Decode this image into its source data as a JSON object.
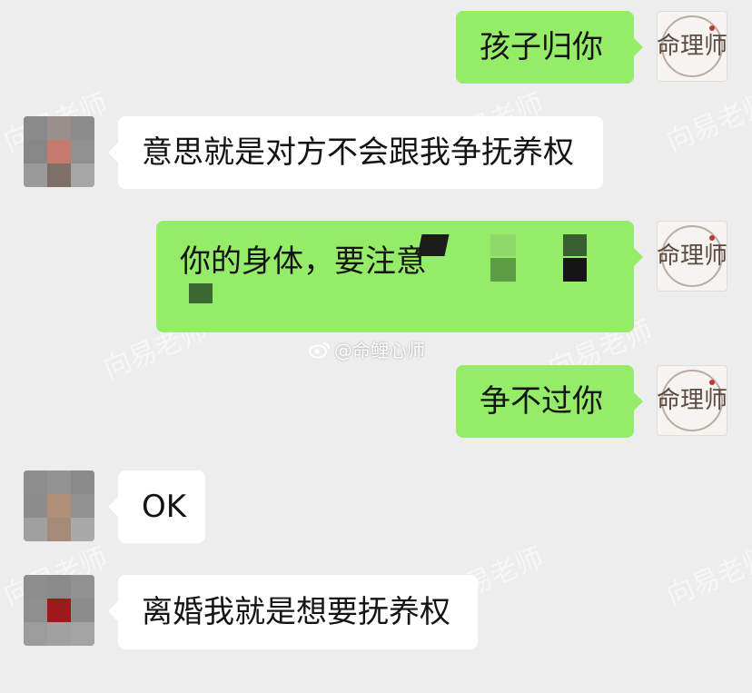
{
  "messages": [
    {
      "side": "right",
      "text": "孩子归你"
    },
    {
      "side": "left",
      "text": "意思就是对方不会跟我争抚养权"
    },
    {
      "side": "right",
      "text": "你的身体，要注意"
    },
    {
      "side": "right",
      "text": "争不过你"
    },
    {
      "side": "left",
      "text": "OK"
    },
    {
      "side": "left",
      "text": "离婚我就是想要抚养权"
    }
  ],
  "brand_avatar": {
    "text": "命理师"
  },
  "watermarks": [
    "向易老师",
    "向易老师",
    "向易老师",
    "向易老师",
    "向易老师",
    "向易老师",
    "向易老师",
    "向易老师"
  ],
  "weibo_tag": "@命鲤心师",
  "colors": {
    "my_bubble": "#95ec69",
    "their_bubble": "#ffffff",
    "background": "#ededed"
  }
}
